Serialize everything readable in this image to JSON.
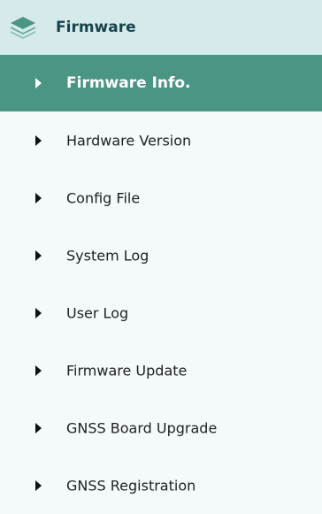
{
  "colors": {
    "header_bg": "#d6eaec",
    "active_bg": "#4b9585",
    "panel_bg": "#f4fafc",
    "text": "#1f1f1f",
    "active_text": "#ffffff"
  },
  "header": {
    "icon": "layers-icon",
    "title": "Firmware"
  },
  "menu": {
    "items": [
      {
        "label": "Firmware Info.",
        "active": true,
        "icon": "caret-right-icon"
      },
      {
        "label": "Hardware Version",
        "active": false,
        "icon": "caret-right-icon"
      },
      {
        "label": "Config File",
        "active": false,
        "icon": "caret-right-icon"
      },
      {
        "label": "System Log",
        "active": false,
        "icon": "caret-right-icon"
      },
      {
        "label": "User Log",
        "active": false,
        "icon": "caret-right-icon"
      },
      {
        "label": "Firmware Update",
        "active": false,
        "icon": "caret-right-icon"
      },
      {
        "label": "GNSS Board Upgrade",
        "active": false,
        "icon": "caret-right-icon"
      },
      {
        "label": "GNSS Registration",
        "active": false,
        "icon": "caret-right-icon"
      }
    ]
  }
}
